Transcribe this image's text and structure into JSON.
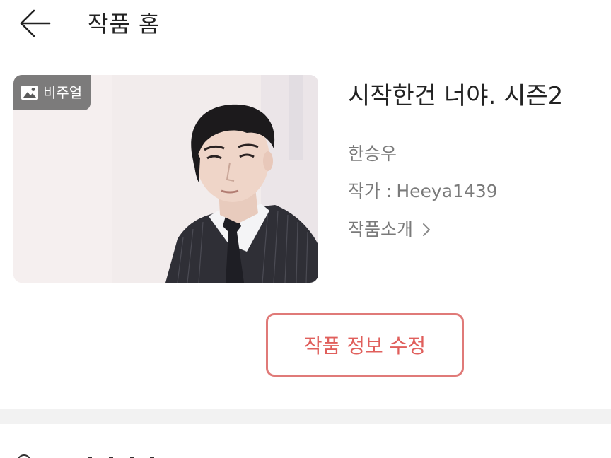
{
  "header": {
    "back_icon": "arrow-left-icon",
    "title": "작품 홈"
  },
  "work": {
    "badge_icon": "image-icon",
    "badge_label": "비주얼",
    "title": "시작한건 너야. 시즌2",
    "character": "한승우",
    "author_label": "작가 :",
    "author_name": "Heeya1439",
    "intro_label": "작품소개",
    "intro_icon": "chevron-right-icon"
  },
  "actions": {
    "edit_label": "작품 정보 수정"
  },
  "colors": {
    "accent": "#e05f5c",
    "separator": "#f2f2f2",
    "text_primary": "#222222",
    "text_secondary": "#7a7a7a"
  }
}
